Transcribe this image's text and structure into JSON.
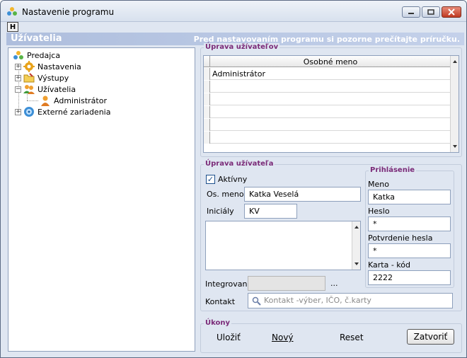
{
  "window": {
    "title": "Nastavenie programu",
    "hotkey": "H"
  },
  "banner": {
    "section": "Užívatelia",
    "hint": "Pred nastavovaním programu si pozorne prečítajte príručku."
  },
  "tree": {
    "items": [
      {
        "label": "Predajca",
        "icon": "shop-icon",
        "expander": ""
      },
      {
        "label": "Nastavenia",
        "icon": "gear-icon",
        "expander": "+"
      },
      {
        "label": "Výstupy",
        "icon": "folder-icon",
        "expander": "+"
      },
      {
        "label": "Užívatelia",
        "icon": "users-icon",
        "expander": "−"
      },
      {
        "label": "Administrátor",
        "icon": "user-icon",
        "expander": ""
      },
      {
        "label": "Externé zariadenia",
        "icon": "device-icon",
        "expander": "+"
      }
    ]
  },
  "users_panel": {
    "title": "Úprava užívateľov",
    "column_header": "Osobné meno",
    "rows": [
      "Administrátor",
      "",
      "",
      "",
      "",
      "",
      "",
      ""
    ]
  },
  "user_form": {
    "title": "Úprava užívateľa",
    "active_label": "Aktívny",
    "name_label": "Os. meno",
    "name_value": "Katka Veselá",
    "initials_label": "Iniciály",
    "initials_value": "KV",
    "integrated_label": "Integrované",
    "integrated_value": "",
    "ellipsis": "...",
    "contact_label": "Kontakt",
    "contact_placeholder": "Kontakt -výber, IČO, č.karty"
  },
  "login": {
    "title": "Prihlásenie",
    "name_label": "Meno",
    "name_value": "Katka",
    "password_label": "Heslo",
    "password_value": "*",
    "confirm_label": "Potvrdenie hesla",
    "confirm_value": "*",
    "card_label": "Karta - kód",
    "card_value": "2222"
  },
  "actions": {
    "title": "Úkony",
    "save": "Uložiť",
    "new": "Nový",
    "reset": "Reset",
    "close": "Zatvoriť"
  },
  "colors": {
    "banner": "#aebedd",
    "group_title": "#7a2a78",
    "close_button": "#c03a22"
  }
}
